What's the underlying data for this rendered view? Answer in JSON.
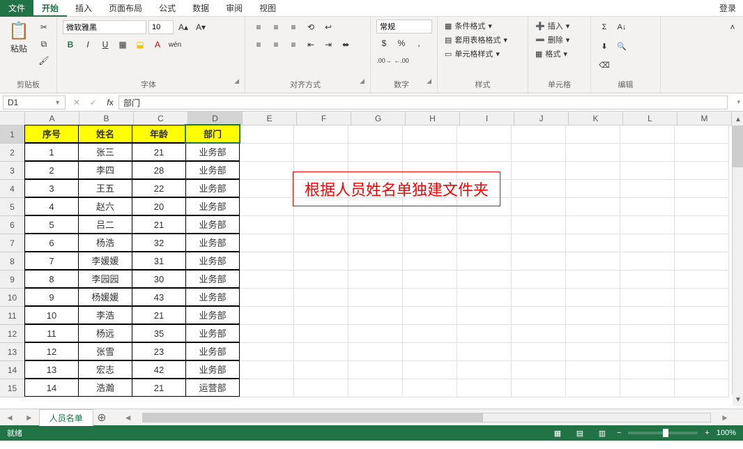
{
  "menu": {
    "file": "文件",
    "home": "开始",
    "insert": "插入",
    "layout": "页面布局",
    "formula": "公式",
    "data": "数据",
    "review": "审阅",
    "view": "视图",
    "login": "登录"
  },
  "ribbon": {
    "clipboard": {
      "paste": "粘贴",
      "label": "剪贴板"
    },
    "font": {
      "name": "微软雅黑",
      "size": "10",
      "label": "字体"
    },
    "align": {
      "label": "对齐方式"
    },
    "number": {
      "format": "常规",
      "label": "数字"
    },
    "styles": {
      "cond": "条件格式",
      "table": "套用表格格式",
      "cell": "单元格样式",
      "label": "样式"
    },
    "cells": {
      "insert": "插入",
      "delete": "删除",
      "format": "格式",
      "label": "单元格"
    },
    "editing": {
      "label": "编辑"
    }
  },
  "namebox": "D1",
  "formula": "部门",
  "columns": [
    "A",
    "B",
    "C",
    "D",
    "E",
    "F",
    "G",
    "H",
    "I",
    "J",
    "K",
    "L",
    "M"
  ],
  "headers": [
    "序号",
    "姓名",
    "年龄",
    "部门"
  ],
  "rows": [
    [
      "1",
      "张三",
      "21",
      "业务部"
    ],
    [
      "2",
      "李四",
      "28",
      "业务部"
    ],
    [
      "3",
      "王五",
      "22",
      "业务部"
    ],
    [
      "4",
      "赵六",
      "20",
      "业务部"
    ],
    [
      "5",
      "吕二",
      "21",
      "业务部"
    ],
    [
      "6",
      "杨浩",
      "32",
      "业务部"
    ],
    [
      "7",
      "李媛媛",
      "31",
      "业务部"
    ],
    [
      "8",
      "李园园",
      "30",
      "业务部"
    ],
    [
      "9",
      "杨媛媛",
      "43",
      "业务部"
    ],
    [
      "10",
      "李浩",
      "21",
      "业务部"
    ],
    [
      "11",
      "杨远",
      "35",
      "业务部"
    ],
    [
      "12",
      "张雪",
      "23",
      "业务部"
    ],
    [
      "13",
      "宏志",
      "42",
      "业务部"
    ],
    [
      "14",
      "浩瀚",
      "21",
      "运营部"
    ]
  ],
  "annotation": "根据人员姓名单独建文件夹",
  "sheet": {
    "name": "人员名单"
  },
  "status": {
    "ready": "就绪",
    "zoom": "100%"
  }
}
